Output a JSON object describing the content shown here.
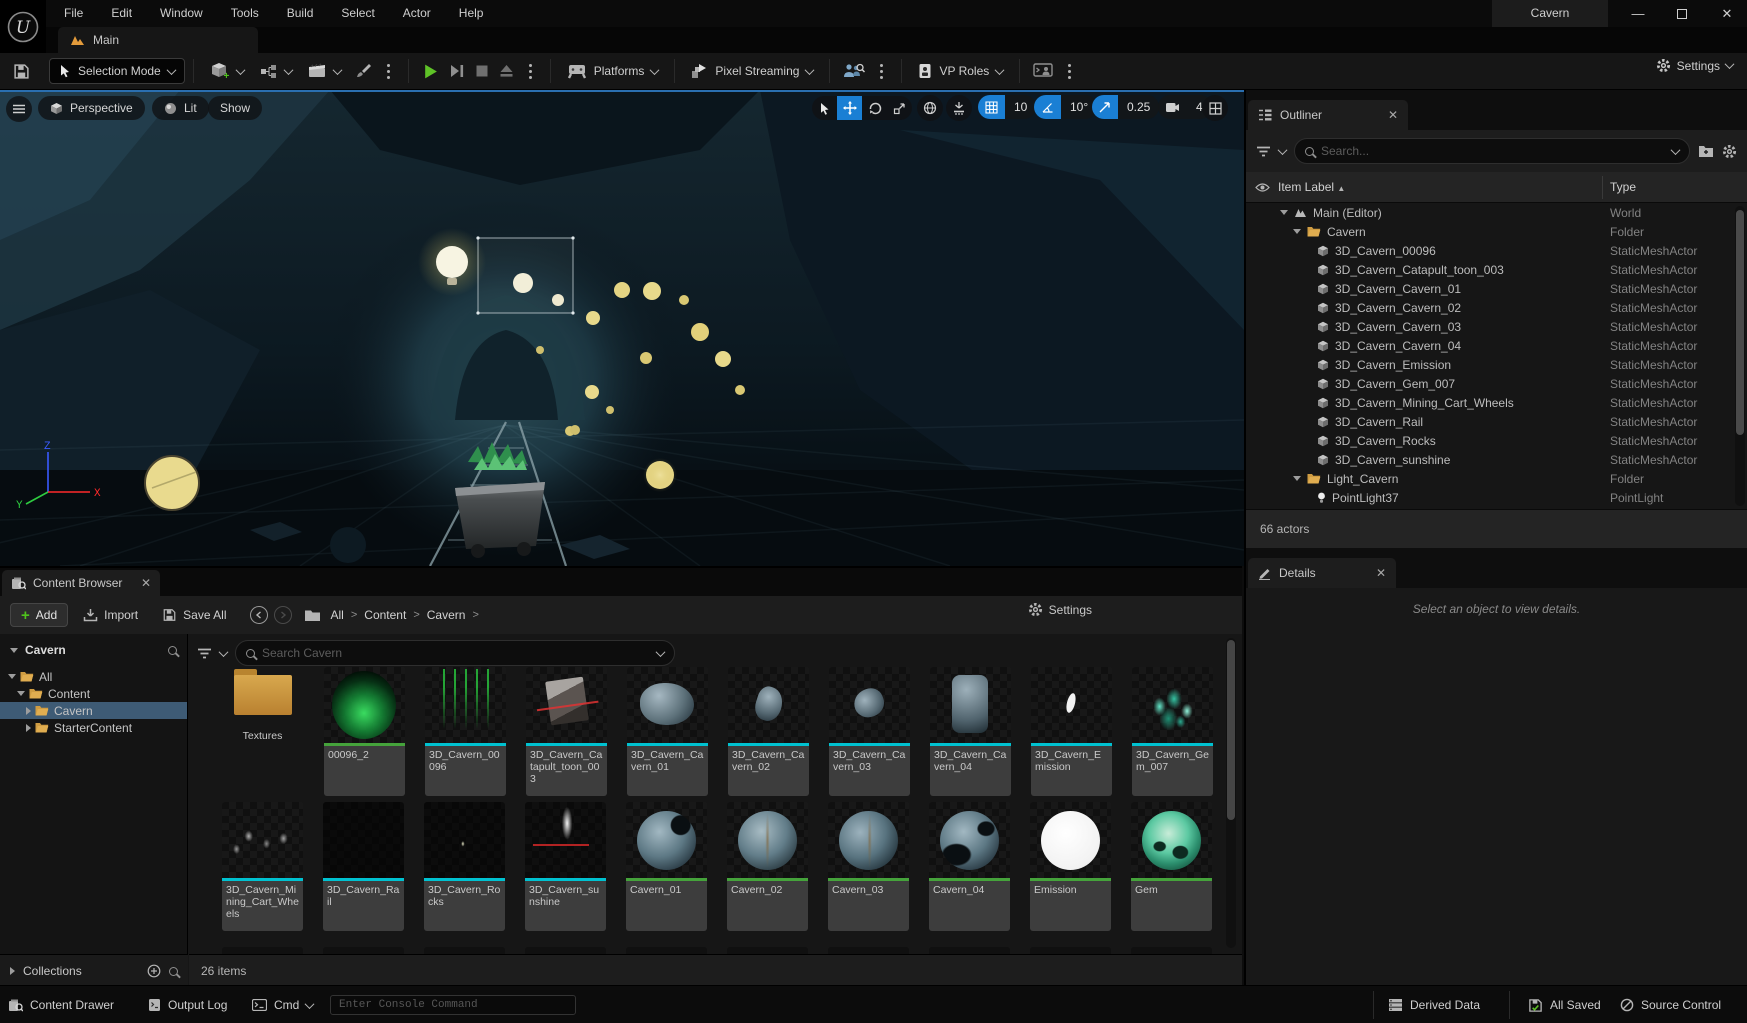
{
  "window": {
    "title": "Cavern"
  },
  "menubar": {
    "items": [
      "File",
      "Edit",
      "Window",
      "Tools",
      "Build",
      "Select",
      "Actor",
      "Help"
    ]
  },
  "tab_main": "Main",
  "toolbar": {
    "selection_mode": "Selection Mode",
    "platforms": "Platforms",
    "pixel_streaming": "Pixel Streaming",
    "vp_roles": "VP Roles",
    "settings": "Settings"
  },
  "viewport": {
    "perspective": "Perspective",
    "lit": "Lit",
    "show": "Show",
    "grid_snap": "10",
    "rotation_snap": "10°",
    "scale_snap": "0.25",
    "camera_speed": "4"
  },
  "outliner": {
    "tab": "Outliner",
    "search_placeholder": "Search...",
    "col_item": "Item Label",
    "sort_glyph": "▲",
    "col_type": "Type",
    "rows": [
      {
        "label": "Main (Editor)",
        "type": "World",
        "icon": "world",
        "depth": 0,
        "arrow": "down"
      },
      {
        "label": "Cavern",
        "type": "Folder",
        "icon": "folder",
        "depth": 1,
        "arrow": "down"
      },
      {
        "label": "3D_Cavern_00096",
        "type": "StaticMeshActor",
        "icon": "mesh",
        "depth": 2,
        "arrow": null
      },
      {
        "label": "3D_Cavern_Catapult_toon_003",
        "type": "StaticMeshActor",
        "icon": "mesh",
        "depth": 2,
        "arrow": null
      },
      {
        "label": "3D_Cavern_Cavern_01",
        "type": "StaticMeshActor",
        "icon": "mesh",
        "depth": 2,
        "arrow": null
      },
      {
        "label": "3D_Cavern_Cavern_02",
        "type": "StaticMeshActor",
        "icon": "mesh",
        "depth": 2,
        "arrow": null
      },
      {
        "label": "3D_Cavern_Cavern_03",
        "type": "StaticMeshActor",
        "icon": "mesh",
        "depth": 2,
        "arrow": null
      },
      {
        "label": "3D_Cavern_Cavern_04",
        "type": "StaticMeshActor",
        "icon": "mesh",
        "depth": 2,
        "arrow": null
      },
      {
        "label": "3D_Cavern_Emission",
        "type": "StaticMeshActor",
        "icon": "mesh",
        "depth": 2,
        "arrow": null
      },
      {
        "label": "3D_Cavern_Gem_007",
        "type": "StaticMeshActor",
        "icon": "mesh",
        "depth": 2,
        "arrow": null
      },
      {
        "label": "3D_Cavern_Mining_Cart_Wheels",
        "type": "StaticMeshActor",
        "icon": "mesh",
        "depth": 2,
        "arrow": null
      },
      {
        "label": "3D_Cavern_Rail",
        "type": "StaticMeshActor",
        "icon": "mesh",
        "depth": 2,
        "arrow": null
      },
      {
        "label": "3D_Cavern_Rocks",
        "type": "StaticMeshActor",
        "icon": "mesh",
        "depth": 2,
        "arrow": null
      },
      {
        "label": "3D_Cavern_sunshine",
        "type": "StaticMeshActor",
        "icon": "mesh",
        "depth": 2,
        "arrow": null
      },
      {
        "label": "Light_Cavern",
        "type": "Folder",
        "icon": "folder",
        "depth": 1,
        "arrow": "down"
      },
      {
        "label": "PointLight37",
        "type": "PointLight",
        "icon": "light",
        "depth": 2,
        "arrow": null
      }
    ],
    "status": "66 actors"
  },
  "details": {
    "tab": "Details",
    "empty": "Select an object to view details."
  },
  "content_browser": {
    "tab": "Content Browser",
    "add": "Add",
    "import": "Import",
    "save_all": "Save All",
    "breadcrumbs": [
      "All",
      "Content",
      "Cavern"
    ],
    "crumb_sep": ">",
    "settings": "Settings",
    "sources_title": "Cavern",
    "tree": [
      {
        "label": "All",
        "depth": 0,
        "arrow": "down",
        "selected": false
      },
      {
        "label": "Content",
        "depth": 1,
        "arrow": "down",
        "selected": false
      },
      {
        "label": "Cavern",
        "depth": 2,
        "arrow": "right",
        "selected": true
      },
      {
        "label": "StarterContent",
        "depth": 2,
        "arrow": "right",
        "selected": false
      }
    ],
    "search_placeholder": "Search Cavern",
    "collections": "Collections",
    "status": "26 items",
    "assets_row1": [
      {
        "name": "Textures",
        "kind": "folder"
      },
      {
        "name": "00096_2",
        "stripe": "green",
        "thumb": "gem-dark"
      },
      {
        "name": "3D_Cavern_00096",
        "stripe": "cyan",
        "thumb": "vines"
      },
      {
        "name": "3D_Cavern_Catapult_toon_003",
        "stripe": "cyan",
        "thumb": "catapult"
      },
      {
        "name": "3D_Cavern_Cavern_01",
        "stripe": "cyan",
        "thumb": "rock-big"
      },
      {
        "name": "3D_Cavern_Cavern_02",
        "stripe": "cyan",
        "thumb": "rock-shard"
      },
      {
        "name": "3D_Cavern_Cavern_03",
        "stripe": "cyan",
        "thumb": "rock-shard2"
      },
      {
        "name": "3D_Cavern_Cavern_04",
        "stripe": "cyan",
        "thumb": "rock-col"
      },
      {
        "name": "3D_Cavern_Emission",
        "stripe": "cyan",
        "thumb": "sliver"
      },
      {
        "name": "3D_Cavern_Gem_007",
        "stripe": "cyan",
        "thumb": "crystals"
      }
    ],
    "assets_row2": [
      {
        "name": "3D_Cavern_Mining_Cart_Wheels",
        "stripe": "cyan",
        "thumb": "wheels"
      },
      {
        "name": "3D_Cavern_Rail",
        "stripe": "cyan",
        "thumb": "dark"
      },
      {
        "name": "3D_Cavern_Rocks",
        "stripe": "cyan",
        "thumb": "dark-speck"
      },
      {
        "name": "3D_Cavern_sunshine",
        "stripe": "cyan",
        "thumb": "sunshine"
      },
      {
        "name": "Cavern_01",
        "stripe": "green",
        "thumb": "sphere1"
      },
      {
        "name": "Cavern_02",
        "stripe": "green",
        "thumb": "sphere2"
      },
      {
        "name": "Cavern_03",
        "stripe": "green",
        "thumb": "sphere3"
      },
      {
        "name": "Cavern_04",
        "stripe": "green",
        "thumb": "sphere4"
      },
      {
        "name": "Emission",
        "stripe": "green",
        "thumb": "sphere-white"
      },
      {
        "name": "Gem",
        "stripe": "green",
        "thumb": "sphere-gem"
      }
    ]
  },
  "statusbar": {
    "content_drawer": "Content Drawer",
    "output_log": "Output Log",
    "cmd": "Cmd",
    "console_placeholder": "Enter Console Command",
    "derived_data": "Derived Data",
    "all_saved": "All Saved",
    "source_control": "Source Control"
  },
  "colors": {
    "accent_blue": "#1a7fd4",
    "play_green": "#5fc327",
    "add_green": "#4fc31c",
    "folder_orange": "#c9913d",
    "stripe_cyan": "#00c2d1",
    "stripe_green": "#45a33b",
    "selection_blue": "#3e5b75",
    "tab_icon_orange": "#e39b3b"
  }
}
